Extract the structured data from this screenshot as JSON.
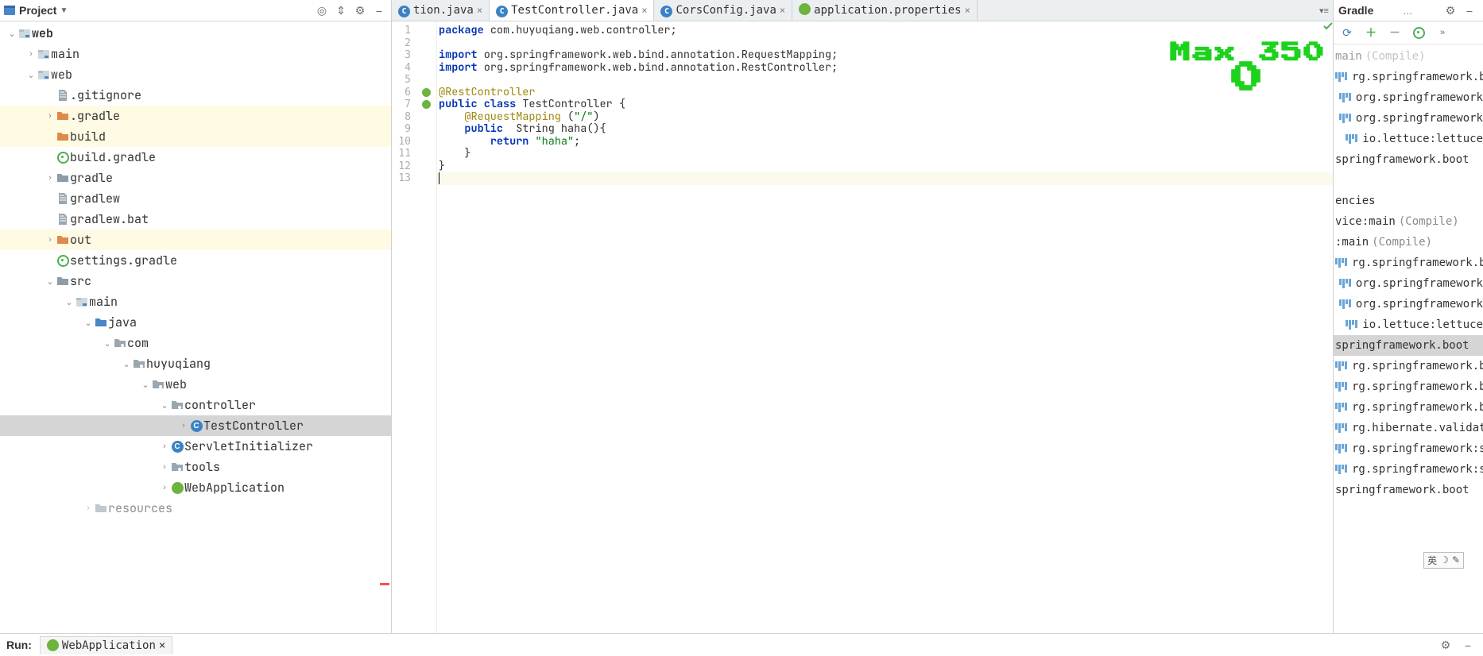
{
  "projectPanel": {
    "title": "Project",
    "tree": [
      {
        "indent": 0,
        "arrow": "down",
        "icon": "module",
        "label": "web",
        "top": true
      },
      {
        "indent": 1,
        "arrow": "right",
        "icon": "module",
        "label": "main"
      },
      {
        "indent": 1,
        "arrow": "down",
        "icon": "module",
        "label": "web"
      },
      {
        "indent": 2,
        "arrow": "",
        "icon": "file",
        "label": ".gitignore"
      },
      {
        "indent": 2,
        "arrow": "right",
        "icon": "folder-orange",
        "label": ".gradle",
        "hl": true
      },
      {
        "indent": 2,
        "arrow": "",
        "icon": "folder-orange",
        "label": "build",
        "hl": true
      },
      {
        "indent": 2,
        "arrow": "",
        "icon": "gradle",
        "label": "build.gradle"
      },
      {
        "indent": 2,
        "arrow": "right",
        "icon": "folder",
        "label": "gradle"
      },
      {
        "indent": 2,
        "arrow": "",
        "icon": "file",
        "label": "gradlew"
      },
      {
        "indent": 2,
        "arrow": "",
        "icon": "file",
        "label": "gradlew.bat"
      },
      {
        "indent": 2,
        "arrow": "right",
        "icon": "folder-orange",
        "label": "out",
        "hl": true
      },
      {
        "indent": 2,
        "arrow": "",
        "icon": "gradle",
        "label": "settings.gradle"
      },
      {
        "indent": 2,
        "arrow": "down",
        "icon": "folder",
        "label": "src"
      },
      {
        "indent": 3,
        "arrow": "down",
        "icon": "module",
        "label": "main"
      },
      {
        "indent": 4,
        "arrow": "down",
        "icon": "folder-src",
        "label": "java"
      },
      {
        "indent": 5,
        "arrow": "down",
        "icon": "folder-pkg",
        "label": "com"
      },
      {
        "indent": 6,
        "arrow": "down",
        "icon": "folder-pkg",
        "label": "huyuqiang"
      },
      {
        "indent": 7,
        "arrow": "down",
        "icon": "folder-pkg",
        "label": "web"
      },
      {
        "indent": 8,
        "arrow": "down",
        "icon": "folder-pkg",
        "label": "controller"
      },
      {
        "indent": 9,
        "arrow": "right",
        "icon": "class",
        "label": "TestController",
        "sel": true
      },
      {
        "indent": 8,
        "arrow": "right",
        "icon": "class",
        "label": "ServletInitializer"
      },
      {
        "indent": 8,
        "arrow": "right",
        "icon": "folder-pkg",
        "label": "tools"
      },
      {
        "indent": 8,
        "arrow": "right",
        "icon": "spring",
        "label": "WebApplication"
      },
      {
        "indent": 4,
        "arrow": "right",
        "icon": "folder",
        "label": "resources",
        "cut": true
      }
    ]
  },
  "tabs": [
    {
      "icon": "class",
      "label": "tion.java",
      "close": true
    },
    {
      "icon": "class",
      "label": "TestController.java",
      "close": true,
      "active": true
    },
    {
      "icon": "class",
      "label": "CorsConfig.java",
      "close": true
    },
    {
      "icon": "spring",
      "label": "application.properties",
      "close": true
    }
  ],
  "code": {
    "lines": [
      {
        "n": 1,
        "html": "<span class='kw'>package</span> <span class='pkgc'>com.huyuqiang.web.controller;</span>"
      },
      {
        "n": 2,
        "html": ""
      },
      {
        "n": 3,
        "html": "<span class='kw'>import</span> <span class='pkgc'>org.springframework.web.bind.annotation.</span><span class='cls'>RequestMapping</span>;"
      },
      {
        "n": 4,
        "html": "<span class='kw'>import</span> <span class='pkgc'>org.springframework.web.bind.annotation.</span><span class='cls'>RestController</span>;"
      },
      {
        "n": 5,
        "html": ""
      },
      {
        "n": 6,
        "html": "<span class='ann'>@RestController</span>",
        "gutter": "spring"
      },
      {
        "n": 7,
        "html": "<span class='kw'>public</span> <span class='kw'>class</span> TestController {",
        "gutter": "spring"
      },
      {
        "n": 8,
        "html": "    <span class='ann'>@RequestMapping</span> (<span class='str'>\"/\"</span>)"
      },
      {
        "n": 9,
        "html": "    <span class='kw'>public</span>  String haha(){"
      },
      {
        "n": 10,
        "html": "        <span class='kw'>return</span> <span class='str'>\"haha\"</span>;"
      },
      {
        "n": 11,
        "html": "    }"
      },
      {
        "n": 12,
        "html": "}"
      },
      {
        "n": 13,
        "html": "<span class='caret-bar'></span>",
        "caret": true
      }
    ]
  },
  "overlay": {
    "top": "Max  350",
    "big": "0"
  },
  "gradlePanel": {
    "title": "Gradle",
    "ell": "...",
    "items": [
      {
        "text": "main",
        "suffix": " (Compile)",
        "bars": false,
        "cut": true
      },
      {
        "text": "rg.springframework.b",
        "bars": true
      },
      {
        "text": "org.springframework",
        "bars": true,
        "indent": true
      },
      {
        "text": "org.springframework",
        "bars": true,
        "indent": true
      },
      {
        "text": "io.lettuce:lettuce",
        "bars": true,
        "indent": true
      },
      {
        "text": "springframework.boot",
        "bars": false
      },
      {
        "text": ""
      },
      {
        "text": "encies"
      },
      {
        "text": "vice:main",
        "suffix": " (Compile)"
      },
      {
        "text": ":main",
        "suffix": " (Compile)"
      },
      {
        "text": "rg.springframework.b",
        "bars": true
      },
      {
        "text": "org.springframework",
        "bars": true,
        "indent": true
      },
      {
        "text": "org.springframework",
        "bars": true,
        "indent": true
      },
      {
        "text": "io.lettuce:lettuce",
        "bars": true,
        "indent": true
      },
      {
        "text": "springframework.boot",
        "sel": true
      },
      {
        "text": "rg.springframework.b",
        "bars": true
      },
      {
        "text": "rg.springframework.b",
        "bars": true
      },
      {
        "text": "rg.springframework.b",
        "bars": true
      },
      {
        "text": "rg.hibernate.validat",
        "bars": true
      },
      {
        "text": "rg.springframework:s",
        "bars": true
      },
      {
        "text": "rg.springframework:s",
        "bars": true
      },
      {
        "text": "springframework.boot"
      }
    ]
  },
  "bottom": {
    "runLabel": "Run:",
    "runConfig": "WebApplication"
  },
  "ime": {
    "lang": "英",
    "moon": "☽",
    "brush": "✎"
  }
}
